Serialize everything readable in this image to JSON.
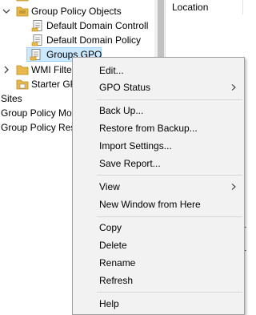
{
  "tree": {
    "items": [
      {
        "label": "Group Policy Objects"
      },
      {
        "label": "Default Domain Controll"
      },
      {
        "label": "Default Domain Policy"
      },
      {
        "label": "Groups GPO"
      },
      {
        "label": "WMI Filte"
      },
      {
        "label": "Starter GP"
      },
      {
        "label": "Sites"
      },
      {
        "label": "Group Policy Mo"
      },
      {
        "label": "Group Policy Res"
      }
    ]
  },
  "right_pane": {
    "column_header": "Location",
    "fragments": [
      "r",
      "r"
    ]
  },
  "context_menu": {
    "items": [
      {
        "label": "Edit..."
      },
      {
        "label": "GPO Status"
      },
      {
        "label": "Back Up..."
      },
      {
        "label": "Restore from Backup..."
      },
      {
        "label": "Import Settings..."
      },
      {
        "label": "Save Report..."
      },
      {
        "label": "View"
      },
      {
        "label": "New Window from Here"
      },
      {
        "label": "Copy"
      },
      {
        "label": "Delete"
      },
      {
        "label": "Rename"
      },
      {
        "label": "Refresh"
      },
      {
        "label": "Help"
      }
    ]
  },
  "colors": {
    "selection": "#cce8ff",
    "selection_border": "#99d1ff",
    "menu_background": "#f2f2f2",
    "folder": "#e8b84a"
  }
}
